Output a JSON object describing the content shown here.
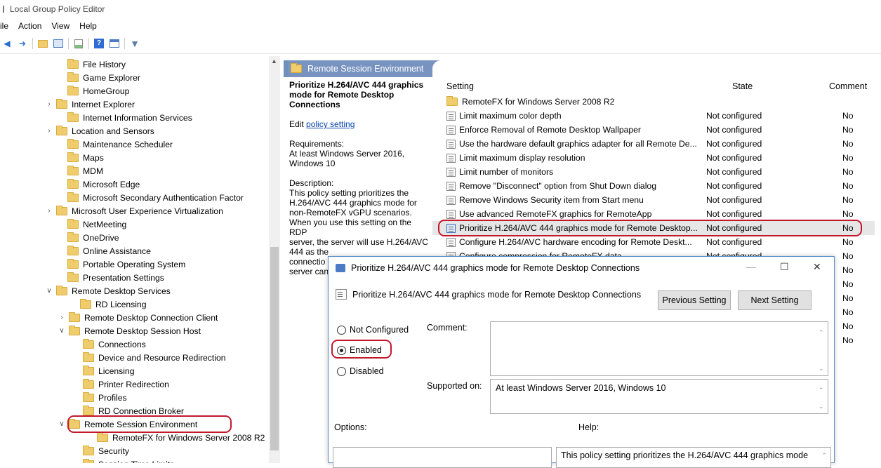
{
  "window": {
    "title": "Local Group Policy Editor"
  },
  "menu": [
    "ile",
    "Action",
    "View",
    "Help"
  ],
  "toolbar": {
    "icons": [
      "back-icon",
      "forward-icon",
      "up-folder-icon",
      "show-hide-tree-icon",
      "export-list-icon",
      "help-icon",
      "properties-icon",
      "filter-icon"
    ]
  },
  "tree": {
    "items": [
      {
        "label": "File History"
      },
      {
        "label": "Game Explorer"
      },
      {
        "label": "HomeGroup"
      },
      {
        "label": "Internet Explorer",
        "expandable": true
      },
      {
        "label": "Internet Information Services"
      },
      {
        "label": "Location and Sensors",
        "expandable": true
      },
      {
        "label": "Maintenance Scheduler"
      },
      {
        "label": "Maps"
      },
      {
        "label": "MDM"
      },
      {
        "label": "Microsoft Edge"
      },
      {
        "label": "Microsoft Secondary Authentication Factor"
      },
      {
        "label": "Microsoft User Experience Virtualization",
        "expandable": true
      },
      {
        "label": "NetMeeting"
      },
      {
        "label": "OneDrive"
      },
      {
        "label": "Online Assistance"
      },
      {
        "label": "Portable Operating System"
      },
      {
        "label": "Presentation Settings"
      },
      {
        "label": "Remote Desktop Services",
        "expanded": true
      },
      {
        "label": "RD Licensing"
      },
      {
        "label": "Remote Desktop Connection Client",
        "expandable": true
      },
      {
        "label": "Remote Desktop Session Host",
        "expanded": true
      },
      {
        "label": "Connections"
      },
      {
        "label": "Device and Resource Redirection"
      },
      {
        "label": "Licensing"
      },
      {
        "label": "Printer Redirection"
      },
      {
        "label": "Profiles"
      },
      {
        "label": "RD Connection Broker"
      },
      {
        "label": "Remote Session Environment",
        "expanded": true,
        "selected": true
      },
      {
        "label": "RemoteFX for Windows Server 2008 R2"
      },
      {
        "label": "Security"
      },
      {
        "label": "Session Time Limits"
      }
    ]
  },
  "pane": {
    "header": "Remote Session Environment",
    "desc_title": "Prioritize H.264/AVC 444 graphics mode for Remote Desktop Connections",
    "edit_prefix": "Edit",
    "edit_link": "policy setting",
    "requirements_label": "Requirements:",
    "requirements_text": "At least Windows Server 2016, Windows 10",
    "description_label": "Description:",
    "description_lines": [
      "This policy setting prioritizes the",
      "H.264/AVC 444 graphics mode for",
      "non-RemoteFX vGPU scenarios.",
      "When you use this setting on the RDP",
      "server, the server will use H.264/AVC",
      "444 as the",
      "connectio",
      "server can"
    ]
  },
  "settings": {
    "columns": {
      "setting": "Setting",
      "state": "State",
      "comment": "Comment"
    },
    "rows": [
      {
        "name": "RemoteFX for Windows Server 2008 R2",
        "state": "",
        "comment": "",
        "folder": true
      },
      {
        "name": "Limit maximum color depth",
        "state": "Not configured",
        "comment": "No"
      },
      {
        "name": "Enforce Removal of Remote Desktop Wallpaper",
        "state": "Not configured",
        "comment": "No"
      },
      {
        "name": "Use the hardware default graphics adapter for all Remote De...",
        "state": "Not configured",
        "comment": "No"
      },
      {
        "name": "Limit maximum display resolution",
        "state": "Not configured",
        "comment": "No"
      },
      {
        "name": "Limit number of monitors",
        "state": "Not configured",
        "comment": "No"
      },
      {
        "name": "Remove \"Disconnect\" option from Shut Down dialog",
        "state": "Not configured",
        "comment": "No"
      },
      {
        "name": "Remove Windows Security item from Start menu",
        "state": "Not configured",
        "comment": "No"
      },
      {
        "name": "Use advanced RemoteFX graphics for RemoteApp",
        "state": "Not configured",
        "comment": "No"
      },
      {
        "name": "Prioritize H.264/AVC 444 graphics mode for Remote Desktop...",
        "state": "Not configured",
        "comment": "No",
        "selected": true
      },
      {
        "name": "Configure H.264/AVC hardware encoding for Remote Deskt...",
        "state": "Not configured",
        "comment": "No"
      },
      {
        "name": "Configure compression for RemoteFX data",
        "state": "Not configured",
        "comment": "No"
      },
      {
        "name": "",
        "state": "",
        "comment": "No"
      },
      {
        "name": "",
        "state": "",
        "comment": "No"
      },
      {
        "name": "",
        "state": "",
        "comment": "No"
      },
      {
        "name": "",
        "state": "",
        "comment": "No"
      },
      {
        "name": "",
        "state": "",
        "comment": "No"
      },
      {
        "name": "",
        "state": "",
        "comment": "No"
      }
    ]
  },
  "dialog": {
    "title": "Prioritize H.264/AVC 444 graphics mode for Remote Desktop Connections",
    "subtitle": "Prioritize H.264/AVC 444 graphics mode for Remote Desktop Connections",
    "prev_button": "Previous Setting",
    "next_button": "Next Setting",
    "options": [
      "Not Configured",
      "Enabled",
      "Disabled"
    ],
    "selected_option": "Enabled",
    "comment_label": "Comment:",
    "supported_label": "Supported on:",
    "supported_value": "At least Windows Server 2016, Windows 10",
    "options_label": "Options:",
    "help_label": "Help:",
    "help_text": "This policy setting prioritizes the H.264/AVC 444 graphics mode",
    "controls": {
      "minimize": "—",
      "maximize": "☐",
      "close": "✕"
    }
  },
  "colors": {
    "highlight_red": "#c2192d",
    "header_blue": "#7893bf",
    "folder_yellow": "#f0cd6c"
  }
}
